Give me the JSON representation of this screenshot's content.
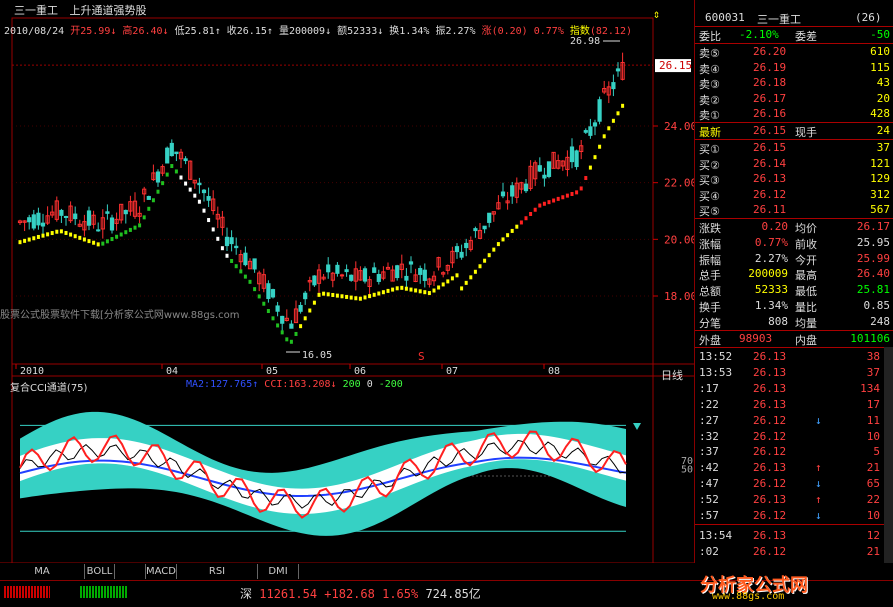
{
  "header": {
    "stock_name": "三一重工",
    "indicator_name": "上升通道强势股",
    "date": "2010/08/24",
    "open_label": "开",
    "open": "25.99",
    "high_label": "高",
    "high": "26.40",
    "low_label": "低",
    "low": "25.81",
    "close_label": "收",
    "close": "26.15",
    "volume_label": "量",
    "volume": "200009",
    "amount_label": "额",
    "amount": "52333",
    "turnover_label": "换",
    "turnover": "1.34%",
    "amplitude_label": "振",
    "amplitude": "2.27%",
    "change_label": "涨",
    "change": "(0.20)",
    "change_pct": "0.77%",
    "index_label": "指数",
    "index_val": "(82.12)"
  },
  "main_chart": {
    "y_ticks": [
      "24.00",
      "22.00",
      "20.00",
      "18.00"
    ],
    "price_tag": "26.15",
    "high_note": "26.98",
    "low_note": "16.05",
    "x_labels": [
      "2010",
      "04",
      "05",
      "06",
      "07",
      "08"
    ],
    "period": "日线",
    "watermark": "股票公式股票软件下载[分析家公式网www.88gs.com",
    "marker": "S"
  },
  "sub_chart": {
    "title": "复合CCI通道(75)",
    "legend_ma": "MA2:127.765",
    "legend_cci": "CCI:163.208",
    "legend_200": "200",
    "legend_0": "0",
    "legend_m200": "-200",
    "y_ticks": [
      "70",
      "50"
    ]
  },
  "tabs": [
    "MA",
    "BOLL",
    "MACD",
    "RSI",
    "DMI"
  ],
  "quote_panel": {
    "code": "600031",
    "name": "三一重工",
    "rank": "(26)",
    "weibi_label": "委比",
    "weibi": "-2.10%",
    "weicha_label": "委差",
    "weicha": "-50",
    "sell": [
      {
        "label": "卖⑤",
        "price": "26.20",
        "vol": "610"
      },
      {
        "label": "卖④",
        "price": "26.19",
        "vol": "115"
      },
      {
        "label": "卖③",
        "price": "26.18",
        "vol": "43"
      },
      {
        "label": "卖②",
        "price": "26.17",
        "vol": "20"
      },
      {
        "label": "卖①",
        "price": "26.16",
        "vol": "428"
      }
    ],
    "latest_label": "最新",
    "latest": "26.15",
    "xianshou_label": "现手",
    "xianshou": "24",
    "buy": [
      {
        "label": "买①",
        "price": "26.15",
        "vol": "37"
      },
      {
        "label": "买②",
        "price": "26.14",
        "vol": "121"
      },
      {
        "label": "买③",
        "price": "26.13",
        "vol": "129"
      },
      {
        "label": "买④",
        "price": "26.12",
        "vol": "312"
      },
      {
        "label": "买⑤",
        "price": "26.11",
        "vol": "567"
      }
    ],
    "stats": [
      {
        "l1": "涨跌",
        "v1": "0.20",
        "l2": "均价",
        "v2": "26.17"
      },
      {
        "l1": "涨幅",
        "v1": "0.77%",
        "l2": "前收",
        "v2": "25.95"
      },
      {
        "l1": "振幅",
        "v1": "2.27%",
        "l2": "今开",
        "v2": "25.99"
      },
      {
        "l1": "总手",
        "v1": "200009",
        "l2": "最高",
        "v2": "26.40"
      },
      {
        "l1": "总额",
        "v1": "52333",
        "l2": "最低",
        "v2": "25.81"
      },
      {
        "l1": "换手",
        "v1": "1.34%",
        "l2": "量比",
        "v2": "0.85"
      },
      {
        "l1": "分笔",
        "v1": "808",
        "l2": "均量",
        "v2": "248"
      }
    ],
    "waipan_label": "外盘",
    "waipan": "98903",
    "neipan_label": "内盘",
    "neipan": "101106",
    "ticks": [
      {
        "t": "13:52",
        "p": "26.13",
        "a": "",
        "v": "38"
      },
      {
        "t": "13:53",
        "p": "26.13",
        "a": "",
        "v": "37"
      },
      {
        "t": ":17",
        "p": "26.13",
        "a": "",
        "v": "134"
      },
      {
        "t": ":22",
        "p": "26.13",
        "a": "",
        "v": "17"
      },
      {
        "t": ":27",
        "p": "26.12",
        "a": "↓",
        "v": "11"
      },
      {
        "t": ":32",
        "p": "26.12",
        "a": "",
        "v": "10"
      },
      {
        "t": ":37",
        "p": "26.12",
        "a": "",
        "v": "5"
      },
      {
        "t": ":42",
        "p": "26.13",
        "a": "↑",
        "v": "21"
      },
      {
        "t": ":47",
        "p": "26.12",
        "a": "↓",
        "v": "65"
      },
      {
        "t": ":52",
        "p": "26.13",
        "a": "↑",
        "v": "22"
      },
      {
        "t": ":57",
        "p": "26.12",
        "a": "↓",
        "v": "10"
      },
      {
        "t": "13:54",
        "p": "26.13",
        "a": "",
        "v": "12"
      },
      {
        "t": ":02",
        "p": "26.12",
        "a": "",
        "v": "21"
      }
    ]
  },
  "status_bar": {
    "market": "深",
    "index": "11261.54",
    "change": "+182.68",
    "pct": "1.65%",
    "amount": "724.85亿",
    "brand": "分析家公式网",
    "brand_url": "www.88gs.com"
  },
  "colors": {
    "up": "#ff3030",
    "down": "#00ff00",
    "cyan": "#36d1c4",
    "yellow": "#ffff00",
    "blue": "#3050ff"
  }
}
